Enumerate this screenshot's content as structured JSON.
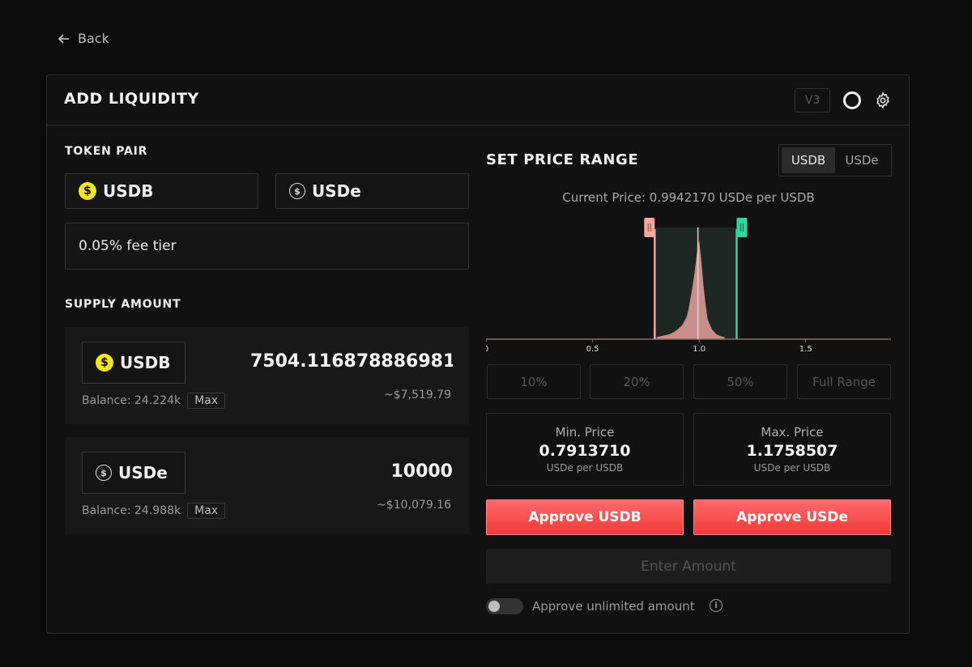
{
  "nav": {
    "back_label": "Back"
  },
  "header": {
    "title": "ADD LIQUIDITY",
    "version_badge": "V3"
  },
  "pair": {
    "section_label": "TOKEN PAIR",
    "token_a": "USDB",
    "token_b": "USDe",
    "fee_tier": "0.05% fee tier"
  },
  "supply": {
    "section_label": "SUPPLY AMOUNT",
    "cards": [
      {
        "token": "USDB",
        "amount": "7504.116878886981",
        "usd": "~$7,519.79",
        "balance": "Balance: 24.224k",
        "max_label": "Max"
      },
      {
        "token": "USDe",
        "amount": "10000",
        "usd": "~$10,079.16",
        "balance": "Balance: 24.988k",
        "max_label": "Max"
      }
    ]
  },
  "range": {
    "title": "SET PRICE RANGE",
    "toggle": [
      "USDB",
      "USDe"
    ],
    "current_price": "Current Price: 0.9942170 USDe per USDB",
    "presets": [
      "10%",
      "20%",
      "50%",
      "Full Range"
    ],
    "min": {
      "label": "Min. Price",
      "value": "0.7913710",
      "unit": "USDe per USDB"
    },
    "max": {
      "label": "Max. Price",
      "value": "1.1758507",
      "unit": "USDe per USDB"
    }
  },
  "chart_data": {
    "type": "area",
    "x_ticks": [
      "0",
      "0.5",
      "1.0",
      "1.5"
    ],
    "xlim": [
      0,
      1.9
    ],
    "current_price": 0.994217,
    "range_min": 0.791371,
    "range_max": 1.1758507,
    "x": [
      0.8,
      0.82,
      0.84,
      0.86,
      0.88,
      0.9,
      0.92,
      0.94,
      0.95,
      0.96,
      0.97,
      0.98,
      0.99,
      1.0,
      1.01,
      1.02,
      1.03,
      1.04,
      1.06,
      1.08,
      1.1,
      1.12
    ],
    "values": [
      0.02,
      0.03,
      0.04,
      0.05,
      0.07,
      0.1,
      0.14,
      0.22,
      0.3,
      0.42,
      0.55,
      0.7,
      0.88,
      1.0,
      0.8,
      0.55,
      0.35,
      0.2,
      0.1,
      0.05,
      0.03,
      0.02
    ]
  },
  "actions": {
    "approve_a": "Approve USDB",
    "approve_b": "Approve USDe",
    "enter_amount": "Enter Amount",
    "unlimited_label": "Approve unlimited amount"
  },
  "colors": {
    "accent": "#f24848",
    "usdb_coin": "#f3e523",
    "range_left": "#f2a8a0",
    "range_right": "#2fd6a0"
  }
}
